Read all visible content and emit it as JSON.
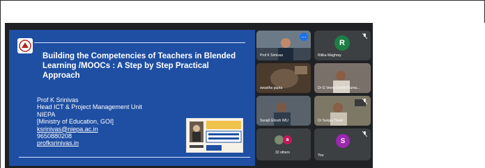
{
  "slide": {
    "title": "Building the Competencies of Teachers in Blended Learning /MOOCs : A Step by Step Practical Approach",
    "lines": [
      "Prof K Srinivas",
      "Head ICT & Project Management Unit",
      "NIEPA",
      "[Ministry of Education, GOI]",
      "ksrinivas@niepa.ac.in",
      "9650880208",
      "profksrinivas.in"
    ]
  },
  "participants": [
    {
      "name": "Prof K Srinivas",
      "type": "video"
    },
    {
      "name": "Ritika Waghray",
      "type": "avatar",
      "initial": "R",
      "color": "#1e7e45"
    },
    {
      "name": "swastha gupta",
      "type": "video"
    },
    {
      "name": "Dr G Veera Senthil Kuma...",
      "type": "video"
    },
    {
      "name": "Surajit Ghosh IMU",
      "type": "video"
    },
    {
      "name": "Dr Sanjay Tiwari",
      "type": "video"
    },
    {
      "name": "32 others",
      "type": "others",
      "initial": "a",
      "color": "#c2185b"
    },
    {
      "name": "You",
      "type": "avatar",
      "initial": "S",
      "color": "#9c27b0"
    }
  ]
}
